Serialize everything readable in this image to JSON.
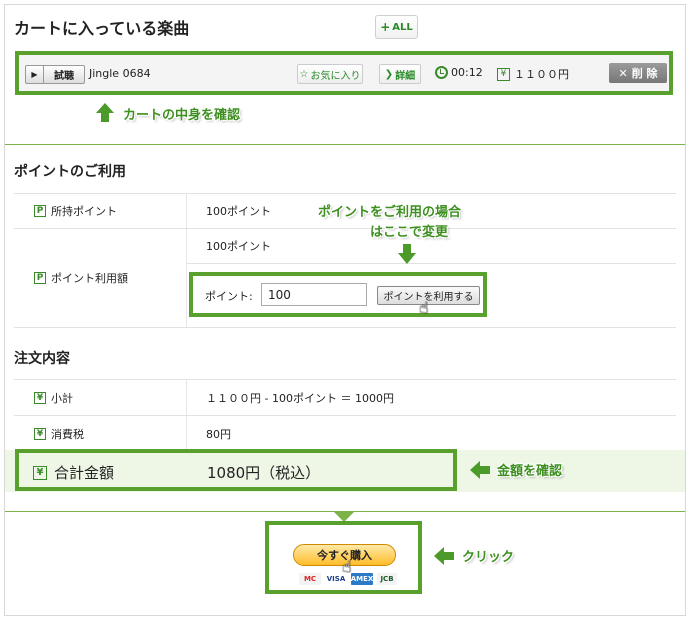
{
  "cart": {
    "title": "カートに入っている楽曲",
    "all_button": "ALL",
    "all_plus": "+",
    "item": {
      "trial_label": "試聴",
      "song_name": "Jingle 0684",
      "favorite_label": "お気に入り",
      "detail_label": "詳細",
      "duration": "00:12",
      "price": "１１００円",
      "delete_label": "削 除"
    },
    "callout": "カートの中身を確認"
  },
  "points": {
    "section_title": "ポイントのご利用",
    "held_label": "所持ポイント",
    "held_value": "100ポイント",
    "use_label": "ポイント利用額",
    "use_value": "100ポイント",
    "input_label": "ポイント:",
    "input_value": "100",
    "use_button": "ポイントを利用する",
    "callout_line1": "ポイントをご利用の場合",
    "callout_line2": "はここで変更"
  },
  "order": {
    "section_title": "注文内容",
    "subtotal_label": "小計",
    "subtotal_value": "１１００円 - 100ポイント ＝ 1000円",
    "tax_label": "消費税",
    "tax_value": "80円",
    "total_label": "合計金額",
    "total_value": "1080円（税込）",
    "callout": "金額を確認"
  },
  "purchase": {
    "buy_button": "今すぐ購入",
    "callout": "クリック",
    "card_brands": [
      "MC",
      "VISA",
      "AMEX",
      "JCB"
    ]
  },
  "icons": {
    "p_badge": "P",
    "yen_badge": "¥"
  },
  "colors": {
    "accent_green": "#5aa02c",
    "callout_green": "#3d8f1f",
    "total_band": "#eef6e6",
    "buy_button": "#ffbd2a"
  }
}
